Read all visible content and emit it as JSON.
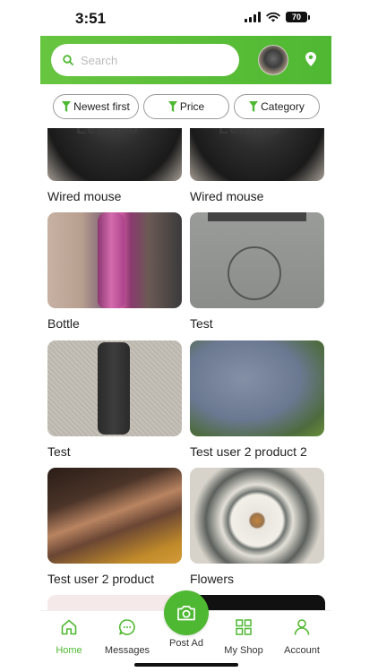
{
  "status_bar": {
    "time": "3:51",
    "battery": "70"
  },
  "header": {
    "search_placeholder": "Search",
    "accent_color": "#4fb832"
  },
  "filters": [
    {
      "label": "Newest first",
      "icon": "filter-icon"
    },
    {
      "label": "Price",
      "icon": "filter-icon"
    },
    {
      "label": "Category",
      "icon": "filter-icon"
    }
  ],
  "products": [
    {
      "title": "Wired mouse"
    },
    {
      "title": "Wired mouse"
    },
    {
      "title": "Bottle"
    },
    {
      "title": "Test"
    },
    {
      "title": "Test"
    },
    {
      "title": "Test user 2 product  2"
    },
    {
      "title": "Test user 2 product"
    },
    {
      "title": "Flowers"
    }
  ],
  "bottom_nav": {
    "home": "Home",
    "messages": "Messages",
    "post_ad": "Post Ad",
    "my_shop": "My Shop",
    "account": "Account"
  }
}
